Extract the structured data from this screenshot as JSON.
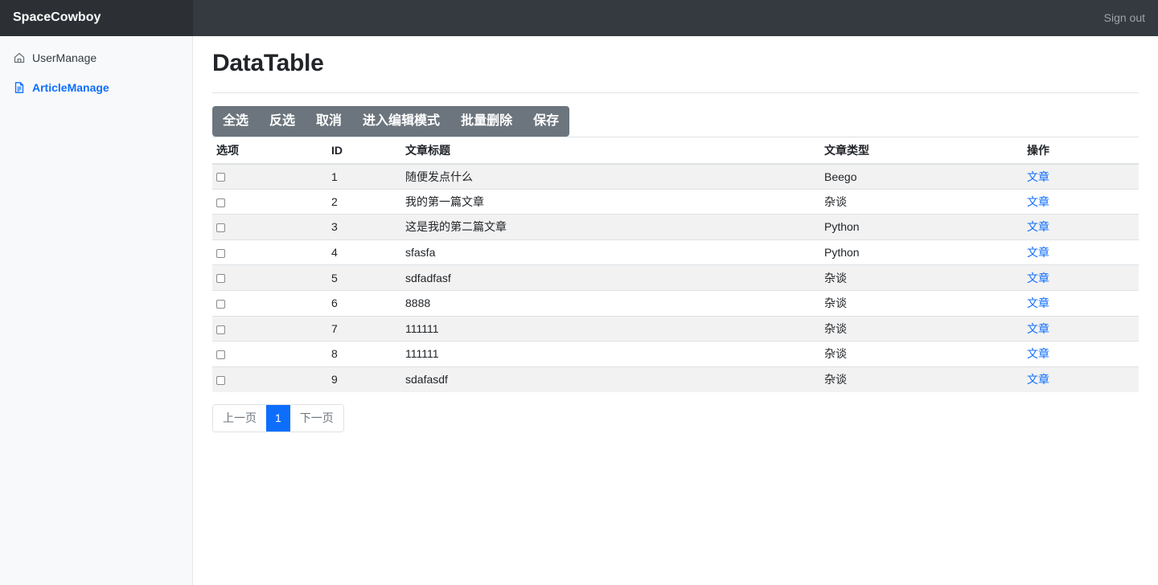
{
  "navbar": {
    "brand": "SpaceCowboy",
    "signout_label": "Sign out"
  },
  "sidebar": {
    "items": [
      {
        "label": "UserManage",
        "icon": "home-icon",
        "active": false
      },
      {
        "label": "ArticleManage",
        "icon": "file-text-icon",
        "active": true
      }
    ]
  },
  "main": {
    "title": "DataTable",
    "toolbar": {
      "select_all": "全选",
      "invert_selection": "反选",
      "cancel": "取消",
      "edit_mode": "进入编辑模式",
      "batch_delete": "批量删除",
      "save": "保存"
    },
    "table": {
      "headers": {
        "option": "选项",
        "id": "ID",
        "title": "文章标题",
        "type": "文章类型",
        "action": "操作"
      },
      "rows": [
        {
          "id": "1",
          "title": "随便发点什么",
          "type": "Beego",
          "action": "文章"
        },
        {
          "id": "2",
          "title": "我的第一篇文章",
          "type": "杂谈",
          "action": "文章"
        },
        {
          "id": "3",
          "title": "这是我的第二篇文章",
          "type": "Python",
          "action": "文章"
        },
        {
          "id": "4",
          "title": "sfasfa",
          "type": "Python",
          "action": "文章"
        },
        {
          "id": "5",
          "title": "sdfadfasf",
          "type": "杂谈",
          "action": "文章"
        },
        {
          "id": "6",
          "title": "8888",
          "type": "杂谈",
          "action": "文章"
        },
        {
          "id": "7",
          "title": "111111",
          "type": "杂谈",
          "action": "文章"
        },
        {
          "id": "8",
          "title": "111111",
          "type": "杂谈",
          "action": "文章"
        },
        {
          "id": "9",
          "title": "sdafasdf",
          "type": "杂谈",
          "action": "文章"
        }
      ]
    },
    "pagination": {
      "prev": "上一页",
      "current": "1",
      "next": "下一页"
    }
  },
  "colors": {
    "navbar_bg": "#343a40",
    "brand_bg": "#2c3035",
    "sidebar_bg": "#f8f9fa",
    "accent": "#0d6efd",
    "toolbar_bg": "#6c757d",
    "stripe": "#f2f2f2"
  }
}
